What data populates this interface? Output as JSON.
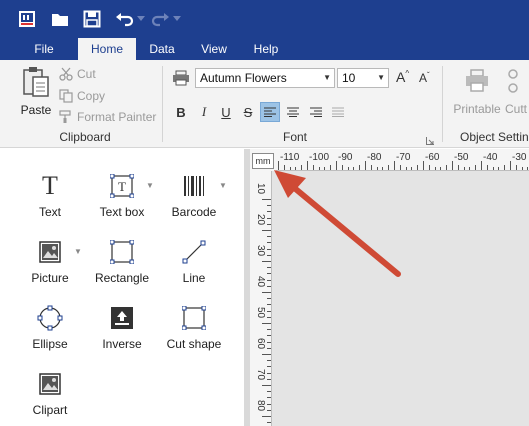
{
  "menu": {
    "tabs": [
      {
        "label": "File"
      },
      {
        "label": "Home"
      },
      {
        "label": "Data"
      },
      {
        "label": "View"
      },
      {
        "label": "Help"
      }
    ],
    "active_tab": "Home"
  },
  "ribbon": {
    "clipboard": {
      "paste_label": "Paste",
      "cut_label": "Cut",
      "copy_label": "Copy",
      "format_painter_label": "Format Painter",
      "group_label": "Clipboard"
    },
    "font": {
      "font_name": "Autumn Flowers",
      "font_size": "10",
      "group_label": "Font"
    },
    "object_settings": {
      "printable_label": "Printable",
      "cut_label": "Cutt",
      "group_label": "Object Settin"
    }
  },
  "tools": [
    {
      "label": "Text"
    },
    {
      "label": "Text box"
    },
    {
      "label": "Barcode"
    },
    {
      "label": "Picture"
    },
    {
      "label": "Rectangle"
    },
    {
      "label": "Line"
    },
    {
      "label": "Ellipse"
    },
    {
      "label": "Inverse"
    },
    {
      "label": "Cut shape"
    },
    {
      "label": "Clipart"
    }
  ],
  "ruler": {
    "unit": "mm",
    "horizontal_labels": [
      "-110",
      "-100",
      "-90",
      "-80",
      "-70",
      "-60",
      "-50",
      "-40",
      "-30"
    ],
    "vertical_labels": [
      "10",
      "20",
      "30",
      "40",
      "50",
      "60",
      "70",
      "80"
    ]
  },
  "colors": {
    "title_bar": "#1e3f8f",
    "ribbon_bg": "#f3f3f3",
    "annotation_arrow": "#cf4a35",
    "active_format_button": "#9cc3e6"
  }
}
